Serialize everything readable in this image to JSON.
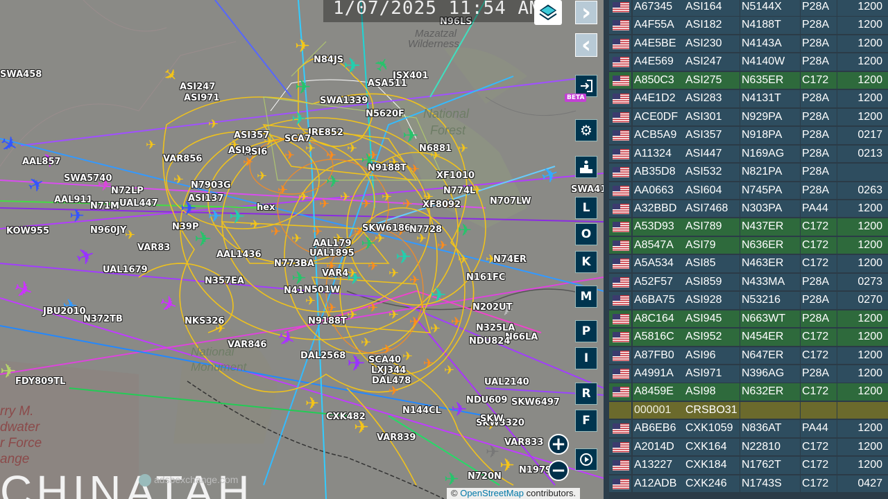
{
  "clock": {
    "time": "1/07/2025 11:54 AM"
  },
  "map": {
    "region_labels": [
      {
        "text": "Mazatzal",
        "style": "italic"
      },
      {
        "text": "Wilderness",
        "style": "italic"
      },
      {
        "text": "National",
        "style": "italic"
      },
      {
        "text": "Forest",
        "style": "italic"
      },
      {
        "text": "National",
        "style": "italic"
      },
      {
        "text": "Monument",
        "style": "italic"
      },
      {
        "text": "rry M.",
        "style": "italic"
      },
      {
        "text": "dwater",
        "style": "italic"
      },
      {
        "text": "r Force",
        "style": "italic"
      },
      {
        "text": "ange",
        "style": "italic"
      },
      {
        "text": "CHINATAH",
        "style": "normal"
      },
      {
        "text": "adsbexchange.com",
        "style": "normal"
      }
    ],
    "plane_labels": [
      "SWA458",
      "N96LS",
      "N84JS",
      "JSX401",
      "ASA511",
      "ASI247",
      "ASI971",
      "SWA1339",
      "N5620F",
      "ASI357",
      "JRE852",
      "SCA7",
      "AAL857",
      "SWA5740",
      "VAR856",
      "N72LP",
      "UAL447",
      "AAL911",
      "N71M",
      "N7903G",
      "ASI137",
      "N39P",
      "KOW955",
      "N960JY",
      "VAR83",
      "UAL1679",
      "AAL1436",
      "N773BA",
      "AAL179",
      "UAL1895",
      "SKW6186",
      "N74ER",
      "N161FC",
      "N7728",
      "VAR4",
      "N41",
      "N501W",
      "JBU2010",
      "N372TB",
      "NKS326",
      "VAR846",
      "DAL2568",
      "SCA40",
      "LXJ344",
      "DAL478",
      "N9188T",
      "N325LA",
      "N66LA",
      "UAL2140",
      "SKW6497",
      "N144CL",
      "CXK482",
      "VAR839",
      "SKW3320",
      "VAR833",
      "N1979",
      "N720N",
      "FDY809TL",
      "N707LW",
      "SWA41",
      "XF1010",
      "N774L",
      "XF8092",
      "N6881",
      "N9188T",
      "NDU824",
      "NDU609",
      "N202UT",
      "SKW",
      "N357EA",
      "hex",
      "ASI6",
      "ASI9"
    ],
    "attribution": {
      "prefix": "©",
      "link": "OpenStreetMap",
      "suffix": "contributors."
    }
  },
  "controls": {
    "next_label": "›",
    "prev_label": "‹",
    "expand_label": "◂▸",
    "beta_label": "BETA",
    "keys": [
      "L",
      "O",
      "K",
      "M",
      "P",
      "I",
      "R",
      "F"
    ],
    "zoom_in": "+",
    "zoom_out": "−"
  },
  "table": {
    "rows": [
      {
        "hex": "A67345",
        "callsign": "ASI164",
        "reg": "N5144X",
        "type": "P28A",
        "squawk": "1200",
        "hl": false
      },
      {
        "hex": "A4F55A",
        "callsign": "ASI182",
        "reg": "N4188T",
        "type": "P28A",
        "squawk": "1200",
        "hl": false
      },
      {
        "hex": "A4E5BE",
        "callsign": "ASI230",
        "reg": "N4143A",
        "type": "P28A",
        "squawk": "1200",
        "hl": false
      },
      {
        "hex": "A4E569",
        "callsign": "ASI247",
        "reg": "N4140W",
        "type": "P28A",
        "squawk": "1200",
        "hl": false
      },
      {
        "hex": "A850C3",
        "callsign": "ASI275",
        "reg": "N635ER",
        "type": "C172",
        "squawk": "1200",
        "hl": true
      },
      {
        "hex": "A4E1D2",
        "callsign": "ASI283",
        "reg": "N4131T",
        "type": "P28A",
        "squawk": "1200",
        "hl": false
      },
      {
        "hex": "ACE0DF",
        "callsign": "ASI301",
        "reg": "N929PA",
        "type": "P28A",
        "squawk": "1200",
        "hl": false
      },
      {
        "hex": "ACB5A9",
        "callsign": "ASI357",
        "reg": "N918PA",
        "type": "P28A",
        "squawk": "0217",
        "hl": false
      },
      {
        "hex": "A11324",
        "callsign": "ASI447",
        "reg": "N169AG",
        "type": "P28A",
        "squawk": "0213",
        "hl": false
      },
      {
        "hex": "AB35D8",
        "callsign": "ASI532",
        "reg": "N821PA",
        "type": "P28A",
        "squawk": "",
        "hl": false
      },
      {
        "hex": "AA0663",
        "callsign": "ASI604",
        "reg": "N745PA",
        "type": "P28A",
        "squawk": "0263",
        "hl": false
      },
      {
        "hex": "A32BBD",
        "callsign": "ASI7468",
        "reg": "N303PA",
        "type": "PA44",
        "squawk": "1200",
        "hl": false
      },
      {
        "hex": "A53D93",
        "callsign": "ASI789",
        "reg": "N437ER",
        "type": "C172",
        "squawk": "1200",
        "hl": true
      },
      {
        "hex": "A8547A",
        "callsign": "ASI79",
        "reg": "N636ER",
        "type": "C172",
        "squawk": "1200",
        "hl": true
      },
      {
        "hex": "A5A534",
        "callsign": "ASI85",
        "reg": "N463ER",
        "type": "C172",
        "squawk": "1200",
        "hl": false
      },
      {
        "hex": "A52F57",
        "callsign": "ASI859",
        "reg": "N433MA",
        "type": "P28A",
        "squawk": "0273",
        "hl": false
      },
      {
        "hex": "A6BA75",
        "callsign": "ASI928",
        "reg": "N53216",
        "type": "P28A",
        "squawk": "0270",
        "hl": false
      },
      {
        "hex": "A8C164",
        "callsign": "ASI945",
        "reg": "N663WT",
        "type": "P28A",
        "squawk": "1200",
        "hl": true
      },
      {
        "hex": "A5816C",
        "callsign": "ASI952",
        "reg": "N454ER",
        "type": "C172",
        "squawk": "1200",
        "hl": true
      },
      {
        "hex": "A87FB0",
        "callsign": "ASI96",
        "reg": "N647ER",
        "type": "C172",
        "squawk": "1200",
        "hl": false
      },
      {
        "hex": "A4991A",
        "callsign": "ASI971",
        "reg": "N396AG",
        "type": "P28A",
        "squawk": "1200",
        "hl": false
      },
      {
        "hex": "A8459E",
        "callsign": "ASI98",
        "reg": "N632ER",
        "type": "C172",
        "squawk": "1200",
        "hl": true
      },
      {
        "hex": "000001",
        "callsign": "CRSBO31",
        "reg": "",
        "type": "",
        "squawk": "",
        "hl": false,
        "tan": true
      },
      {
        "hex": "AB6EB6",
        "callsign": "CXK1059",
        "reg": "N836AT",
        "type": "PA44",
        "squawk": "1200",
        "hl": false
      },
      {
        "hex": "A2014D",
        "callsign": "CXK164",
        "reg": "N22810",
        "type": "C172",
        "squawk": "1200",
        "hl": false
      },
      {
        "hex": "A13227",
        "callsign": "CXK184",
        "reg": "N1762T",
        "type": "C172",
        "squawk": "1200",
        "hl": false
      },
      {
        "hex": "A12ADB",
        "callsign": "CXK246",
        "reg": "N1743S",
        "type": "C172",
        "squawk": "0427",
        "hl": false
      }
    ]
  },
  "colors": {
    "row_normal": "#2e4d5f",
    "row_highlight": "#2e6a3c",
    "row_tan": "#6b6a2c",
    "table_bg": "#2b3b47"
  }
}
